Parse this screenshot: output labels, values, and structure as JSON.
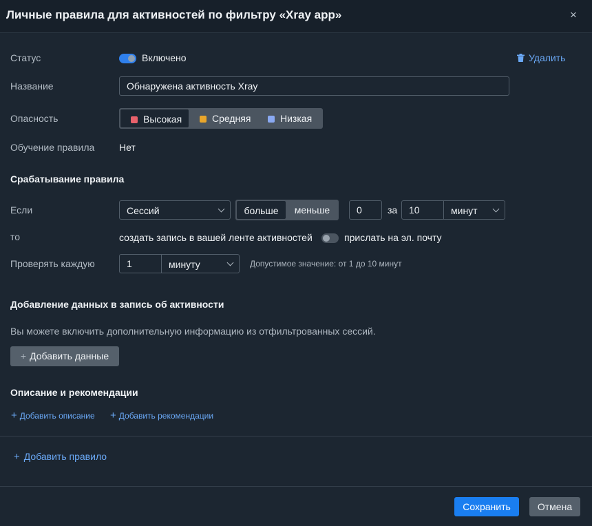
{
  "dialog": {
    "title": "Личные правила для активностей по фильтру «Xray app»",
    "close_icon": "×"
  },
  "status": {
    "label": "Статус",
    "toggle_on": true,
    "value": "Включено",
    "delete_label": "Удалить"
  },
  "name": {
    "label": "Название",
    "value": "Обнаружена активность Xray"
  },
  "severity": {
    "label": "Опасность",
    "options": [
      {
        "label": "Высокая",
        "color": "#e8616b",
        "selected": true
      },
      {
        "label": "Средняя",
        "color": "#e9a62b",
        "selected": false
      },
      {
        "label": "Низкая",
        "color": "#8aa9f2",
        "selected": false
      }
    ]
  },
  "learning": {
    "label": "Обучение правила",
    "value": "Нет"
  },
  "trigger": {
    "section_title": "Срабатывание правила",
    "if_label": "Если",
    "metric_select": "Сессий",
    "comparison": {
      "more": "больше",
      "less": "меньше",
      "selected": "больше"
    },
    "threshold": "0",
    "for_label": "за",
    "period_value": "10",
    "period_unit": "минут",
    "then_label": "то",
    "then_text": "создать запись в вашей ленте активностей",
    "email_toggle_on": false,
    "email_label": "прислать на эл. почту",
    "check_label": "Проверять каждую",
    "check_value": "1",
    "check_unit": "минуту",
    "check_hint": "Допустимое значение: от 1 до 10 минут"
  },
  "add_data": {
    "section_title": "Добавление данных в запись об активности",
    "description": "Вы можете включить дополнительную информацию из отфильтрованных сессий.",
    "button_label": "Добавить данные"
  },
  "desc": {
    "section_title": "Описание и рекомендации",
    "add_description": "Добавить описание",
    "add_recommendations": "Добавить рекомендации"
  },
  "add_rule": "Добавить правило",
  "footer": {
    "save": "Сохранить",
    "cancel": "Отмена"
  }
}
